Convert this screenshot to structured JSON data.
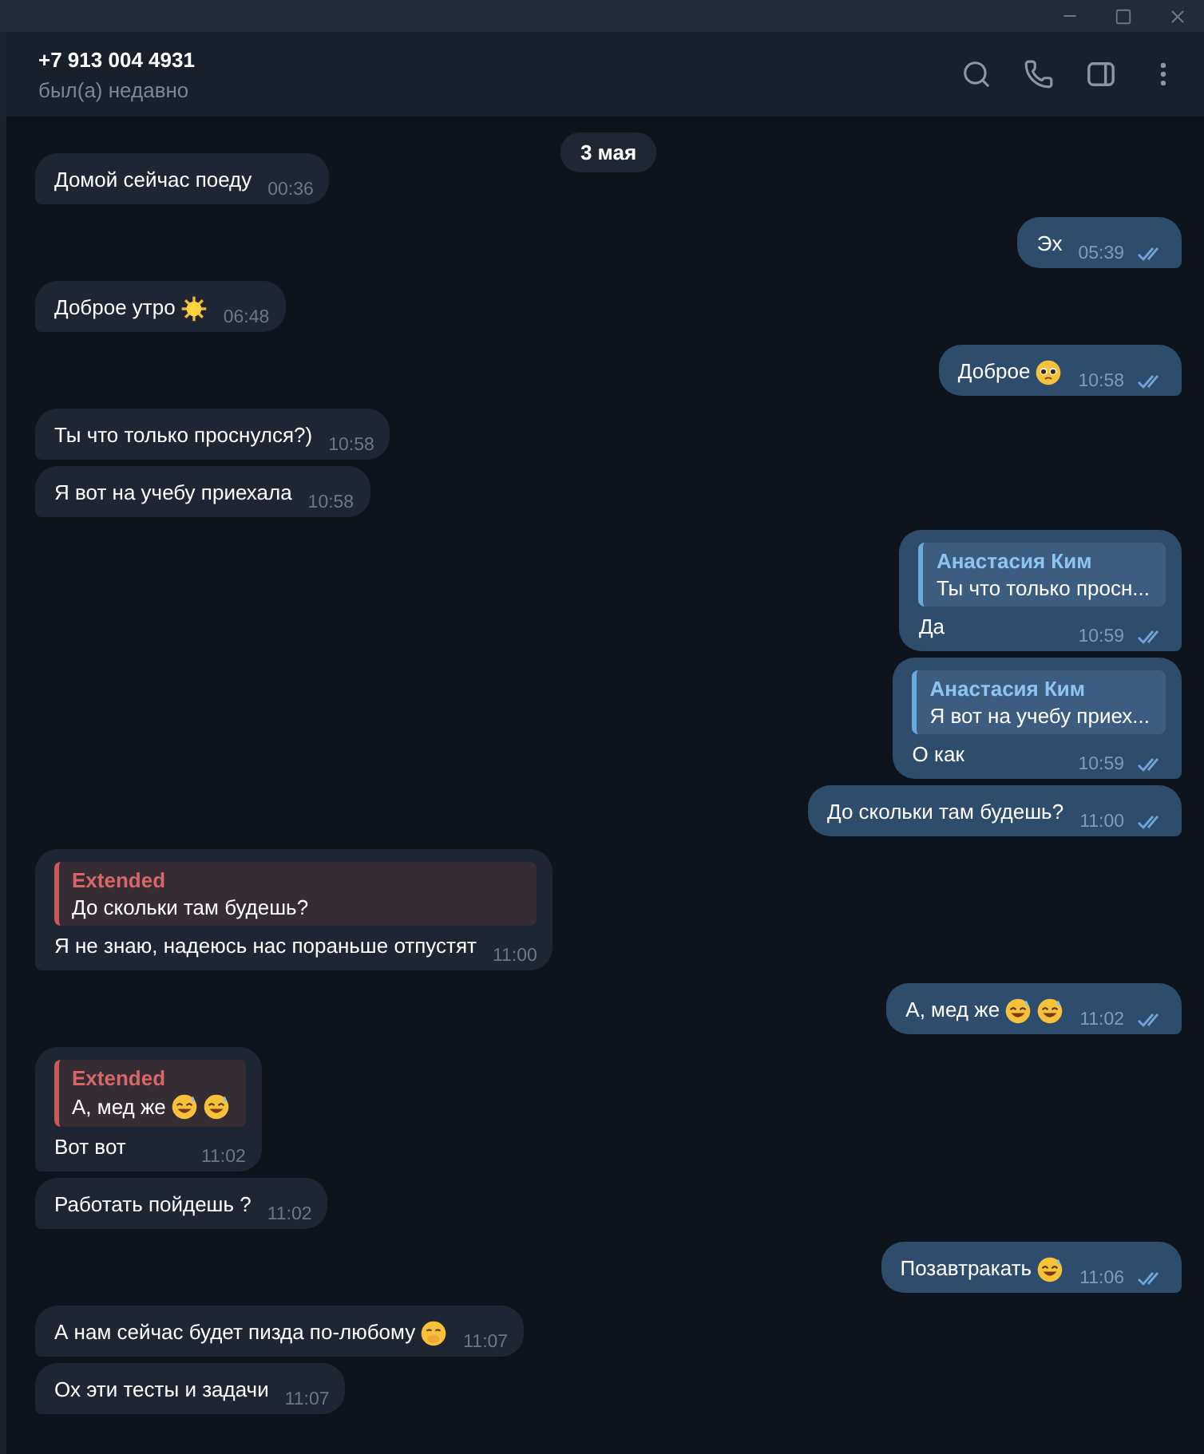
{
  "header": {
    "title": "+7 913 004 4931",
    "status": "был(а) недавно"
  },
  "date_badge": "3 мая",
  "messages": [
    {
      "kind": "incoming",
      "text": "Домой сейчас поеду",
      "time": "00:36"
    },
    {
      "kind": "outgoing",
      "text": "Эх",
      "time": "05:39",
      "read": true
    },
    {
      "kind": "incoming",
      "text": "Доброе утро",
      "emojis": [
        {
          "kind": "sun"
        }
      ],
      "time": "06:48"
    },
    {
      "kind": "outgoing",
      "text": "Доброе",
      "emojis": [
        {
          "kind": "pleading"
        }
      ],
      "time": "10:58",
      "read": true
    },
    {
      "kind": "incoming",
      "text": "Ты что только проснулся?)",
      "time": "10:58"
    },
    {
      "kind": "incoming",
      "text": "Я вот на учебу приехала",
      "time": "10:58"
    },
    {
      "kind": "outgoing",
      "reply": {
        "name": "Анастасия Ким",
        "text": "Ты что только просн..."
      },
      "text": "Да",
      "time": "10:59",
      "read": true
    },
    {
      "kind": "outgoing",
      "reply": {
        "name": "Анастасия Ким",
        "text": "Я вот на учебу приех..."
      },
      "text": "О как",
      "time": "10:59",
      "read": true
    },
    {
      "kind": "outgoing",
      "text": "До скольки там будешь?",
      "time": "11:00",
      "read": true
    },
    {
      "kind": "incoming",
      "reply": {
        "name": "Extended",
        "text": "До скольки там будешь?"
      },
      "text": "Я не знаю, надеюсь нас пораньше отпустят",
      "time": "11:00"
    },
    {
      "kind": "outgoing",
      "text": "А, мед же",
      "emojis": [
        {
          "kind": "sweat_smile"
        },
        {
          "kind": "sweat_smile"
        }
      ],
      "time": "11:02",
      "read": true
    },
    {
      "kind": "incoming",
      "reply": {
        "name": "Extended",
        "text": "А, мед же",
        "emojis": [
          {
            "kind": "sweat_smile"
          },
          {
            "kind": "sweat_smile"
          }
        ]
      },
      "text": "Вот вот",
      "time": "11:02"
    },
    {
      "kind": "incoming",
      "text": "Работать пойдешь ?",
      "time": "11:02"
    },
    {
      "kind": "outgoing",
      "text": "Позавтракать",
      "emojis": [
        {
          "kind": "sweat_smile"
        }
      ],
      "time": "11:06",
      "read": true
    },
    {
      "kind": "incoming",
      "text": "А нам сейчас будет пизда по-любому",
      "emojis": [
        {
          "kind": "hush"
        }
      ],
      "time": "11:07"
    },
    {
      "kind": "incoming",
      "text": "Ох эти тесты и задачи",
      "time": "11:07"
    }
  ]
}
